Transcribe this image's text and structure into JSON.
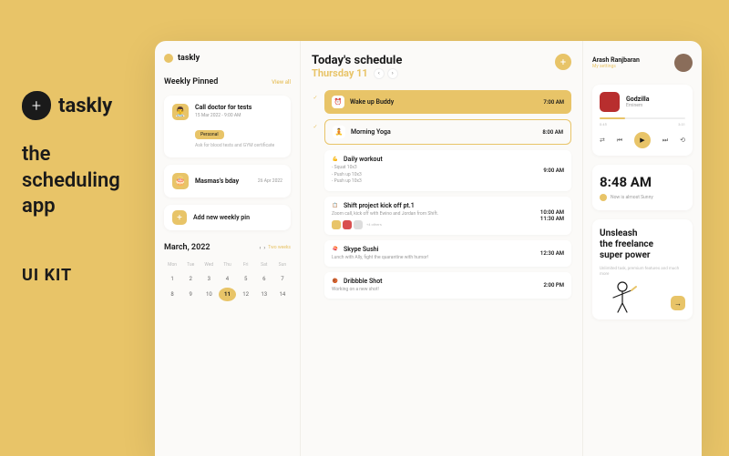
{
  "promo": {
    "brand": "taskly",
    "tagline_l1": "the",
    "tagline_l2": "scheduling",
    "tagline_l3": "app",
    "kit": "UI KIT"
  },
  "app": {
    "brand": "taskly"
  },
  "pinned": {
    "title": "Weekly Pinned",
    "view_all": "View all",
    "items": [
      {
        "title": "Call doctor for tests",
        "date": "15 Mar 2022 - 9:00 AM",
        "tag": "Personal",
        "desc": "Ask for blood tests and GYM certificate"
      },
      {
        "title": "Masmas's bday",
        "date": "26 Apr 2022"
      }
    ],
    "add": "Add new weekly pin"
  },
  "calendar": {
    "title": "March, 2022",
    "link": "Two weeks",
    "dow": [
      "Mon",
      "Tue",
      "Wed",
      "Thu",
      "Fri",
      "Sat",
      "Sun"
    ],
    "days": [
      "1",
      "2",
      "3",
      "4",
      "5",
      "6",
      "7",
      "8",
      "9",
      "10",
      "11",
      "12",
      "13",
      "14"
    ],
    "today_index": 10
  },
  "schedule": {
    "title": "Today's schedule",
    "date": "Thursday 11",
    "items": [
      {
        "done": true,
        "style": "filled",
        "icon": "⏰",
        "title": "Wake up Buddy",
        "time": "7:00 AM"
      },
      {
        "done": true,
        "style": "bordered",
        "icon": "🧘",
        "title": "Morning Yoga",
        "time": "8:00 AM"
      },
      {
        "style": "plain",
        "icon": "💪",
        "title": "Daily workout",
        "time": "9:00 AM",
        "bullets": [
          "Squat 10x3",
          "Push up 10x3",
          "Push up 10x3"
        ]
      },
      {
        "style": "plain",
        "icon": "📋",
        "title": "Shift project kick off pt.1",
        "time": "10:00 AM",
        "time2": "11:30 AM",
        "desc": "Zoom call, kick off with Ewino and Jordan from Shift.",
        "avatars": true,
        "avtext": "+4 others"
      },
      {
        "style": "plain",
        "icon": "🍣",
        "title": "Skype Sushi",
        "time": "12:30 AM",
        "desc": "Lunch with Ally, fight the quarantine with humor!"
      },
      {
        "style": "plain",
        "icon": "🏀",
        "title": "Dribbble Shot",
        "time": "2:00 PM",
        "desc": "Working on a new shot!"
      }
    ]
  },
  "profile": {
    "name": "Arash Ranjbaran",
    "settings": "My settings"
  },
  "music": {
    "title": "Godzilla",
    "artist": "Eminem",
    "start": "0:45",
    "end": "3:31"
  },
  "clock": {
    "time": "8:48 AM",
    "weather": "Now is almost Sunny"
  },
  "promo_card": {
    "title_l1": "Unsleash",
    "title_l2": "the freelance",
    "title_l3": "super power",
    "desc": "Unlimited task, premium features and much more"
  }
}
